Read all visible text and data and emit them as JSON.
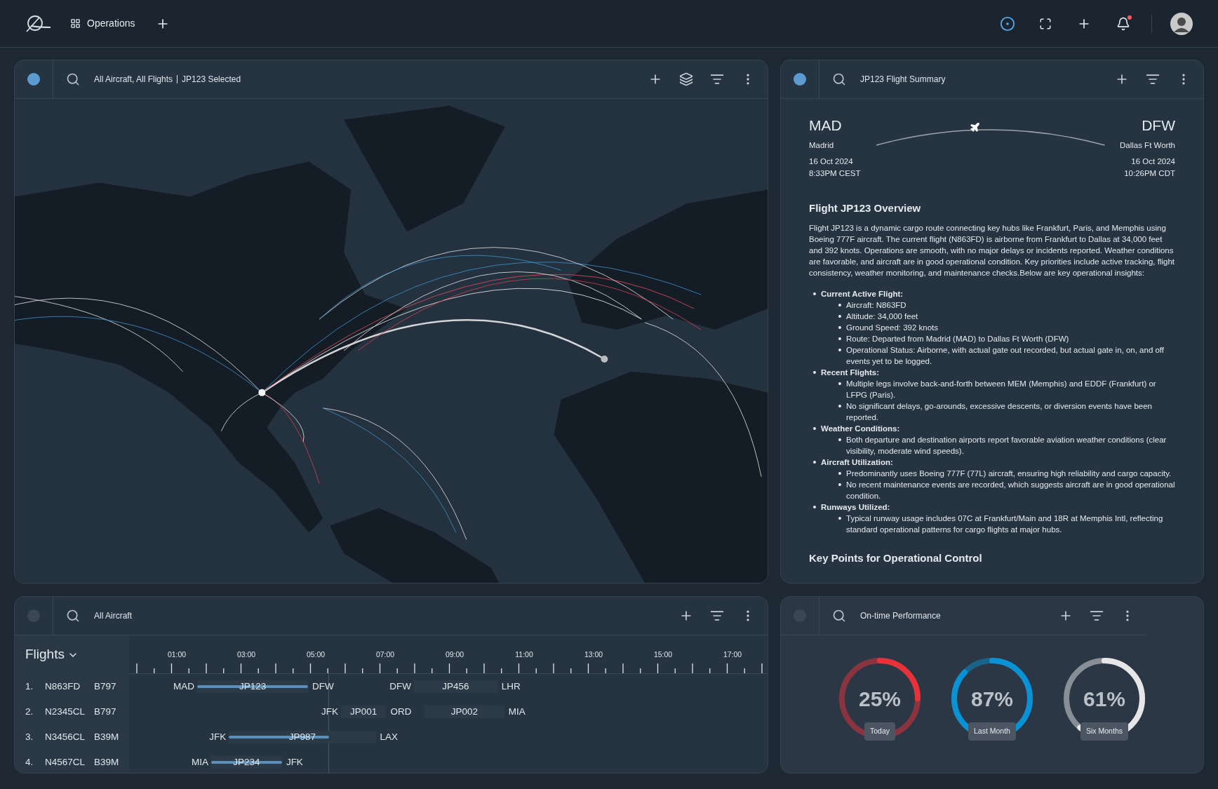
{
  "topbar": {
    "workspace": "Operations",
    "target_active": true,
    "unread_notifications": true
  },
  "map_panel": {
    "active": true,
    "layers": true,
    "query": "All Aircraft, All Flights",
    "selection": "JP123 Selected"
  },
  "summary_panel": {
    "active": true,
    "layers": false,
    "title": "JP123 Flight Summary",
    "origin": {
      "code": "MAD",
      "city": "Madrid",
      "date": "16 Oct 2024",
      "time": "8:33PM CEST"
    },
    "destination": {
      "code": "DFW",
      "city": "Dallas Ft Worth",
      "date": "16 Oct 2024",
      "time": "10:26PM CDT"
    },
    "overview_title": "Flight JP123 Overview",
    "overview_text": "Flight JP123 is a dynamic cargo route connecting key hubs like Frankfurt, Paris, and Memphis using Boeing 777F aircraft. The current flight (N863FD) is airborne from Frankfurt to Dallas at 34,000 feet and 392 knots. Operations are smooth, with no major delays or incidents reported. Weather conditions are favorable, and aircraft are in good operational condition. Key priorities include active tracking, flight consistency, weather monitoring, and maintenance checks.Below are key operational insights:",
    "insights": [
      {
        "heading": "Current Active Flight:",
        "points": [
          "Aircraft: N863FD",
          "Altitude: 34,000 feet",
          "Ground Speed: 392 knots",
          "Route: Departed from Madrid (MAD) to Dallas Ft Worth (DFW)",
          "Operational Status: Airborne, with actual gate out recorded, but actual gate in, on, and off events yet to be logged."
        ]
      },
      {
        "heading": "Recent Flights:",
        "points": [
          "Multiple legs involve back-and-forth between MEM (Memphis) and EDDF (Frankfurt) or LFPG (Paris).",
          "No significant delays, go-arounds, excessive descents, or diversion events have been reported."
        ]
      },
      {
        "heading": "Weather Conditions:",
        "points": [
          "Both departure and destination airports report favorable aviation weather conditions (clear visibility, moderate wind speeds)."
        ]
      },
      {
        "heading": "Aircraft Utilization:",
        "points": [
          "Predominantly uses Boeing 777F (77L) aircraft, ensuring high reliability and cargo capacity.",
          "No recent maintenance events are recorded, which suggests aircraft are in good operational condition."
        ]
      },
      {
        "heading": "Runways Utilized:",
        "points": [
          "Typical runway usage includes 07C at Frankfurt/Main and 18R at Memphis Intl, reflecting standard operational patterns for cargo flights at major hubs."
        ]
      }
    ],
    "section_title": "Key Points for Operational Control"
  },
  "flights_panel": {
    "active": false,
    "layers": false,
    "title": "All Aircraft",
    "list_title": "Flights",
    "time_labels": [
      "01:00",
      "03:00",
      "05:00",
      "07:00",
      "09:00",
      "11:00",
      "13:00",
      "15:00",
      "17:00"
    ],
    "rows": [
      {
        "number": "1.",
        "tail": "N863FD",
        "type": "B797",
        "legs": [
          {
            "from": "MAD",
            "flight": "JP123",
            "to": "DFW",
            "level": 1
          },
          {
            "from": "DFW",
            "flight": "JP456",
            "to": "LHR",
            "level": 0
          }
        ]
      },
      {
        "number": "2.",
        "tail": "N2345CL",
        "type": "B797",
        "legs": [
          {
            "from": "JFK",
            "flight": "JP001",
            "to": "ORD",
            "level": 0
          },
          {
            "flight": "JP002",
            "to": "MIA",
            "level": 0
          }
        ]
      },
      {
        "number": "3.",
        "tail": "N3456CL",
        "type": "B39M",
        "legs": [
          {
            "from": "JFK",
            "flight": "JP987",
            "to": "LAX",
            "level": 0.68
          }
        ]
      },
      {
        "number": "4.",
        "tail": "N4567CL",
        "type": "B39M",
        "legs": [
          {
            "from": "MIA",
            "flight": "JP234",
            "to": "JFK",
            "level": 1
          }
        ]
      }
    ]
  },
  "performance_panel": {
    "active": false,
    "layers": false,
    "title": "On-time Performance",
    "gauges": [
      {
        "value": "25%",
        "label": "Today",
        "color": "#e8323a"
      },
      {
        "value": "87%",
        "label": "Last Month",
        "color": "#0a92d4"
      },
      {
        "value": "61%",
        "label": "Six Months",
        "color": "#e6e6e6"
      }
    ]
  }
}
